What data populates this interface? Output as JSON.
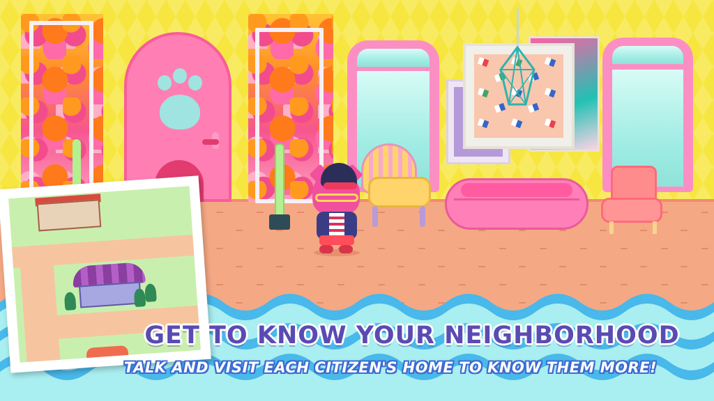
{
  "banner": {
    "title": "GET TO KNOW YOUR NEIGHBORHOOD",
    "subtitle": "TALK AND VISIT EACH CITIZEN'S HOME TO KNOW THEM MORE!"
  },
  "colors": {
    "wall": "#f6e63f",
    "floor": "#f5a884",
    "title_text": "#5a4bb3",
    "subtitle_outline": "#3b6bd1",
    "wave_dark": "#49b8ea",
    "wave_light": "#a9eef0"
  },
  "scene": {
    "room_items": [
      "patterned-panel",
      "paw-door",
      "window",
      "wall-art",
      "chandelier",
      "armchair",
      "inflatable-pool",
      "patterned-chair",
      "floor-lamp",
      "cat-character"
    ],
    "inset": "neighborhood-map-card"
  }
}
